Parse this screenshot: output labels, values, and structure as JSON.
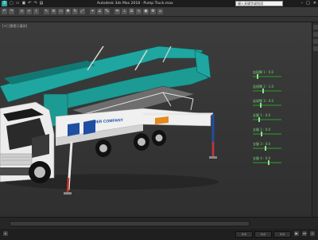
{
  "window": {
    "title": "Autodesk 3ds Max 2018 · Pump Truck.max",
    "search_value": "键入关键字或短语",
    "logo_glyph": "3"
  },
  "viewport": {
    "label": "[+] [透视] [真实]"
  },
  "truck": {
    "side_text": "BIDER COMPANY"
  },
  "parameters": [
    {
      "label": "连接臂 1 : 0.0",
      "level": 0.15
    },
    {
      "label": "连接臂 2 : 1.0",
      "level": 0.35
    },
    {
      "label": "连接臂 3 : 0.0",
      "level": 0.25
    },
    {
      "label": "支腿 1 : 0.0",
      "level": 0.2
    },
    {
      "label": "支腿 2 : 0.0",
      "level": 0.3
    },
    {
      "label": "支腿 3 : 0.0",
      "level": 0.45
    },
    {
      "label": "支腿 4 : 0.0",
      "level": 0.55
    }
  ],
  "status": {
    "x_value": "0.0",
    "y_value": "0.0",
    "z_value": "0.0"
  },
  "colors": {
    "boom": "#1fa6a0",
    "boom_dark": "#137873",
    "cab": "#e8e8e8",
    "accent_blue": "#1e4fa3",
    "accent_red": "#c9352b",
    "param_text": "#7cd27c"
  }
}
